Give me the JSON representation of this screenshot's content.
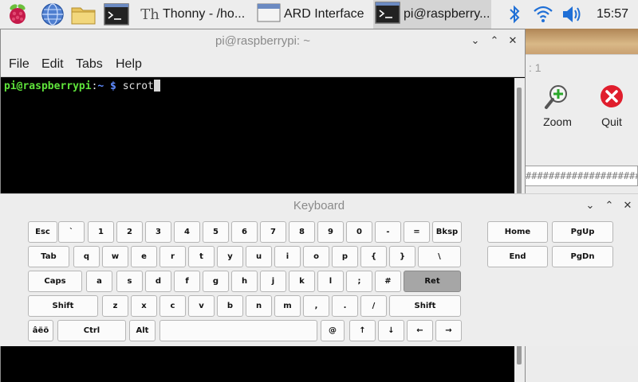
{
  "taskbar": {
    "launchers": [
      {
        "icon": "raspberry-menu-icon"
      },
      {
        "icon": "web-browser-icon"
      },
      {
        "icon": "file-manager-icon"
      },
      {
        "icon": "terminal-icon"
      }
    ],
    "tasks": [
      {
        "label": "Thonny  -  /ho...",
        "icon": "thonny-icon",
        "active": false
      },
      {
        "label": "ARD Interface",
        "icon": "window-icon",
        "active": false
      },
      {
        "label": "pi@raspberry...",
        "icon": "terminal-icon",
        "active": true
      }
    ],
    "tray": [
      "bluetooth-icon",
      "wifi-icon",
      "volume-icon"
    ],
    "clock": "15:57"
  },
  "background_window": {
    "number_label": ": 1",
    "zoom_label": "Zoom",
    "quit_label": "Quit",
    "text_field": "##########################"
  },
  "terminal": {
    "title": "pi@raspberrypi: ~",
    "menu": [
      "File",
      "Edit",
      "Tabs",
      "Help"
    ],
    "prompt_user": "pi@raspberrypi",
    "prompt_sep": ":",
    "prompt_path": "~ $",
    "command": " scrot"
  },
  "keyboard": {
    "title": "Keyboard",
    "rows": [
      [
        "Esc",
        "`",
        "1",
        "2",
        "3",
        "4",
        "5",
        "6",
        "7",
        "8",
        "9",
        "0",
        "-",
        "=",
        "Bksp"
      ],
      [
        "Tab",
        "q",
        "w",
        "e",
        "r",
        "t",
        "y",
        "u",
        "i",
        "o",
        "p",
        "{",
        "}",
        "\\"
      ],
      [
        "Caps",
        "a",
        "s",
        "d",
        "f",
        "g",
        "h",
        "j",
        "k",
        "l",
        ";",
        "#",
        "Ret"
      ],
      [
        "Shift",
        "z",
        "x",
        "c",
        "v",
        "b",
        "n",
        "m",
        ",",
        ".",
        "/",
        "Shift"
      ],
      [
        "âëö",
        "Ctrl",
        "Alt",
        "",
        "@",
        "↑",
        "↓",
        "←",
        "→"
      ]
    ],
    "nav_keys": [
      "Home",
      "PgUp",
      "End",
      "PgDn"
    ],
    "highlighted_key": "Ret"
  }
}
